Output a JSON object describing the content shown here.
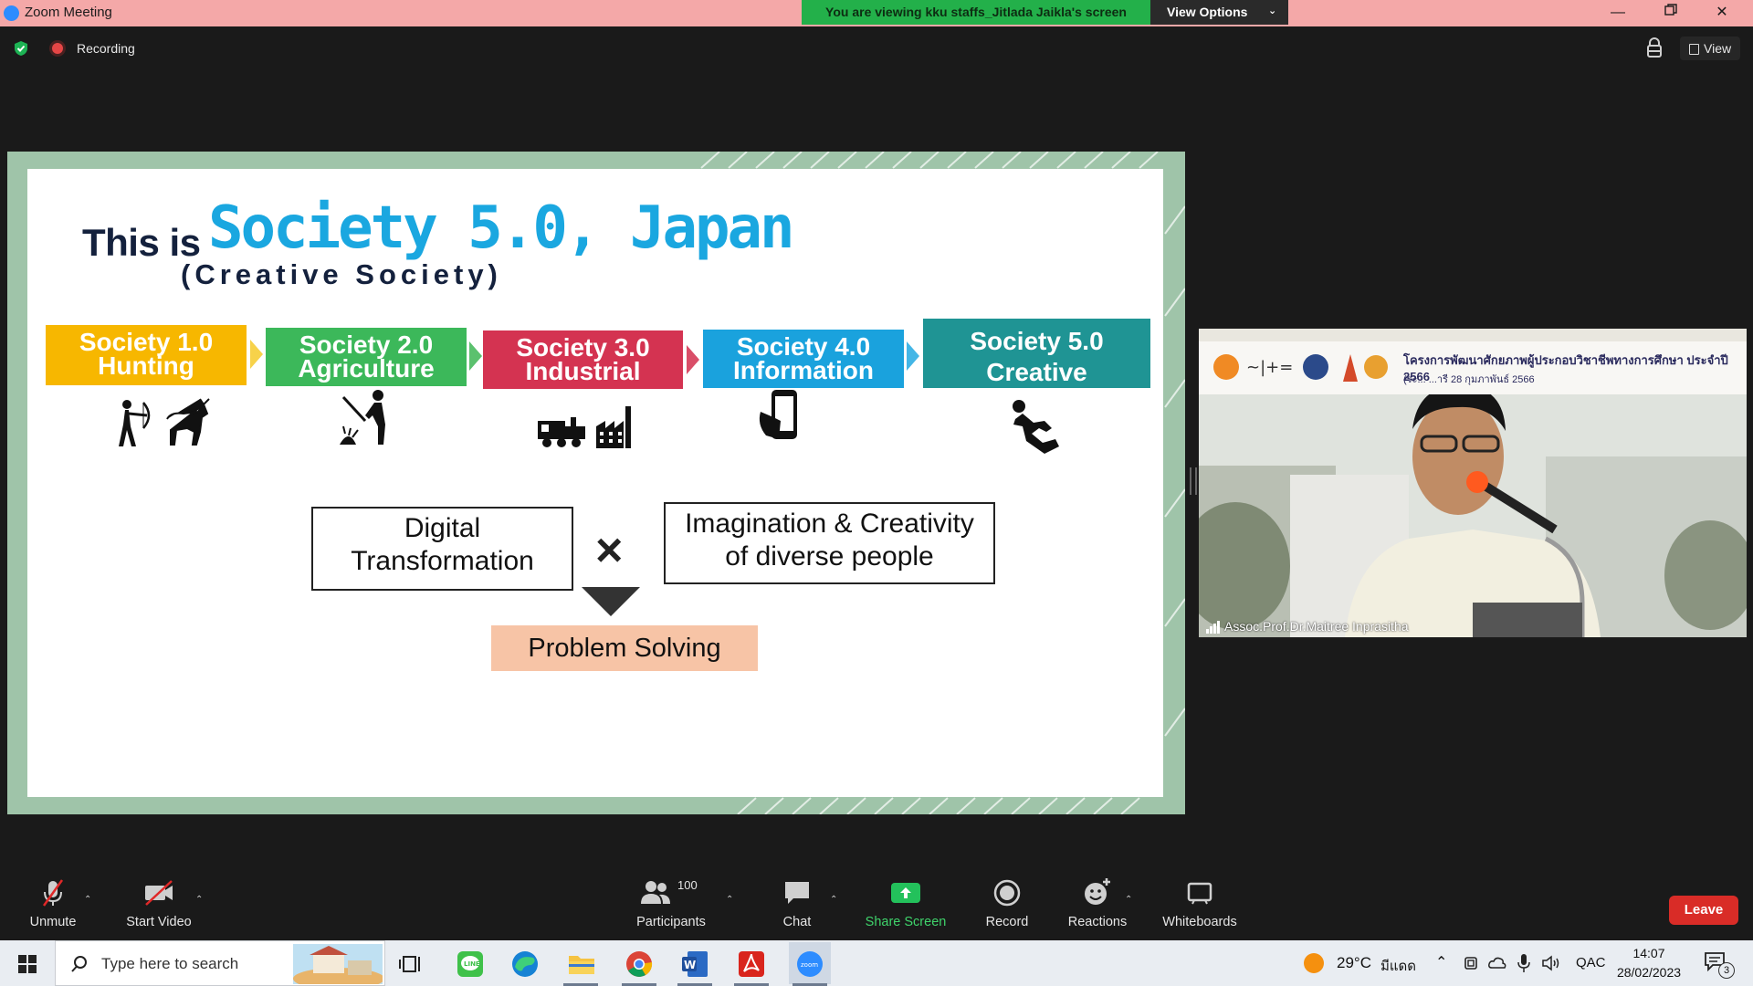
{
  "window": {
    "title": "Zoom Meeting"
  },
  "banner": {
    "viewing": "You are viewing kku staffs_Jitlada Jaikla's screen",
    "view_options": "View Options"
  },
  "meeting": {
    "recording": "Recording",
    "view": "View"
  },
  "slide": {
    "title_prefix": "This is",
    "title_main": "Society 5.0, Japan",
    "subtitle": "(Creative Society)",
    "stages": [
      {
        "line1": "Society 1.0",
        "line2": "Hunting",
        "color": "#f7b700"
      },
      {
        "line1": "Society 2.0",
        "line2": "Agriculture",
        "color": "#3cb85a"
      },
      {
        "line1": "Society 3.0",
        "line2": "Industrial",
        "color": "#d43351"
      },
      {
        "line1": "Society 4.0",
        "line2": "Information",
        "color": "#1aa2dd"
      },
      {
        "line1": "Society 5.0",
        "line2": "Creative",
        "color": "#1f9494"
      }
    ],
    "box_left": [
      "Digital",
      "Transformation"
    ],
    "box_right": [
      "Imagination & Creativity",
      "of diverse people"
    ],
    "times_symbol": "×",
    "result": "Problem Solving"
  },
  "video": {
    "participant_name": "Assoc.Prof.Dr.Maitree Inprasitha",
    "banner_line1": "โครงการพัฒนาศักยภาพผู้ประกอบวิชาชีพทางการศึกษา ประจำปี 2566",
    "banner_line2": "(ระ...      ...ารี 28 กุมภาพันธ์ 2566"
  },
  "toolbar": {
    "unmute": "Unmute",
    "start_video": "Start Video",
    "participants": "Participants",
    "participants_count": "100",
    "chat": "Chat",
    "share_screen": "Share Screen",
    "record": "Record",
    "reactions": "Reactions",
    "whiteboards": "Whiteboards",
    "leave": "Leave"
  },
  "taskbar": {
    "search_placeholder": "Type here to search",
    "weather": "29°C",
    "weather_desc": "มีแดด",
    "ime": "QAC",
    "time": "14:07",
    "date": "28/02/2023",
    "notifications": "3"
  },
  "colors": {
    "zoom_green": "#23b04a",
    "leave_red": "#d92c27",
    "share_green": "#23c15b"
  }
}
